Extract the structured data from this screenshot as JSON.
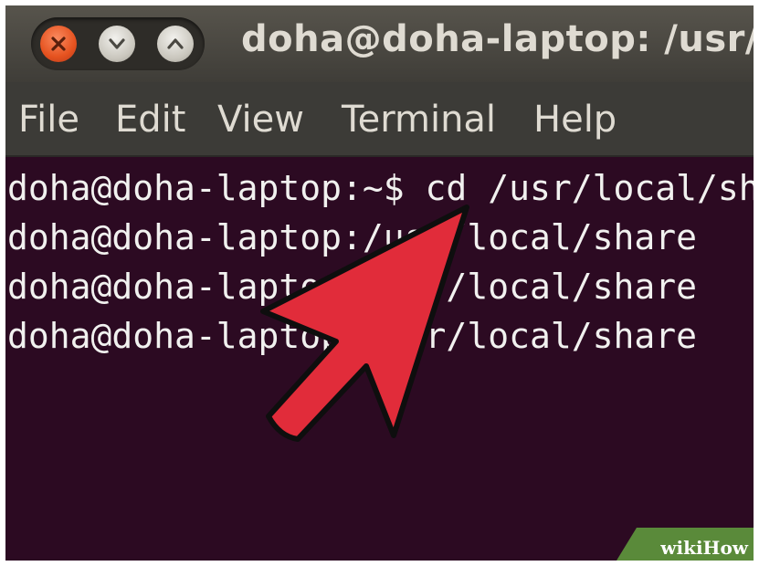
{
  "window": {
    "title": "doha@doha-laptop: /usr/local/share",
    "buttons": [
      {
        "icon": "close-icon",
        "color": "#e5521f"
      },
      {
        "icon": "minimize-icon",
        "color": "#c9c6bd"
      },
      {
        "icon": "maximize-icon",
        "color": "#c9c6bd"
      }
    ]
  },
  "menu": {
    "items": [
      "File",
      "Edit",
      "View",
      "Terminal",
      "Help"
    ]
  },
  "terminal": {
    "background": "#2c0a22",
    "lines": [
      "doha@doha-laptop:~$ cd /usr/local/share",
      "doha@doha-laptop:/usr/local/share",
      "doha@doha-laptop:/usr/local/share",
      "doha@doha-laptop:/usr/local/share"
    ]
  },
  "overlay": {
    "pointer": "red-arrow",
    "color": "#e12c3a"
  },
  "watermark": {
    "part1": "wiki",
    "part2": "How",
    "color": "#5a8a3a"
  }
}
